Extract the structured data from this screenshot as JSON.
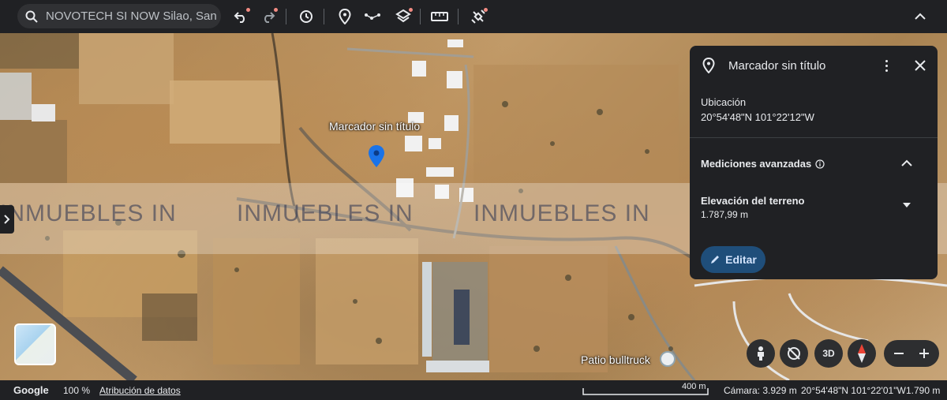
{
  "search": {
    "value": "NOVOTECH SI NOW Silao, San Isi"
  },
  "map": {
    "marker_label": "Marcador sin título",
    "poi_label": "Patio bulltruck",
    "watermark": "INMUEBLES IN"
  },
  "panel": {
    "title": "Marcador sin título",
    "location_label": "Ubicación",
    "location_value": "20°54'48\"N 101°22'12\"W",
    "advanced_label": "Mediciones avanzadas",
    "elevation_label": "Elevación del terreno",
    "elevation_value": "1.787,99 m",
    "edit_label": "Editar"
  },
  "controls": {
    "tilt_label": "3D"
  },
  "bottombar": {
    "brand": "Google",
    "zoom": "100 %",
    "attribution": "Atribución de datos",
    "scale": "400 m",
    "camera": "Cámara: 3.929 m",
    "coords": "20°54'48\"N 101°22'01\"W",
    "elevation": "1.790 m"
  },
  "colors": {
    "toolbar": "#202124",
    "accent_button": "#1f4e7a",
    "marker": "#1a73e8"
  }
}
